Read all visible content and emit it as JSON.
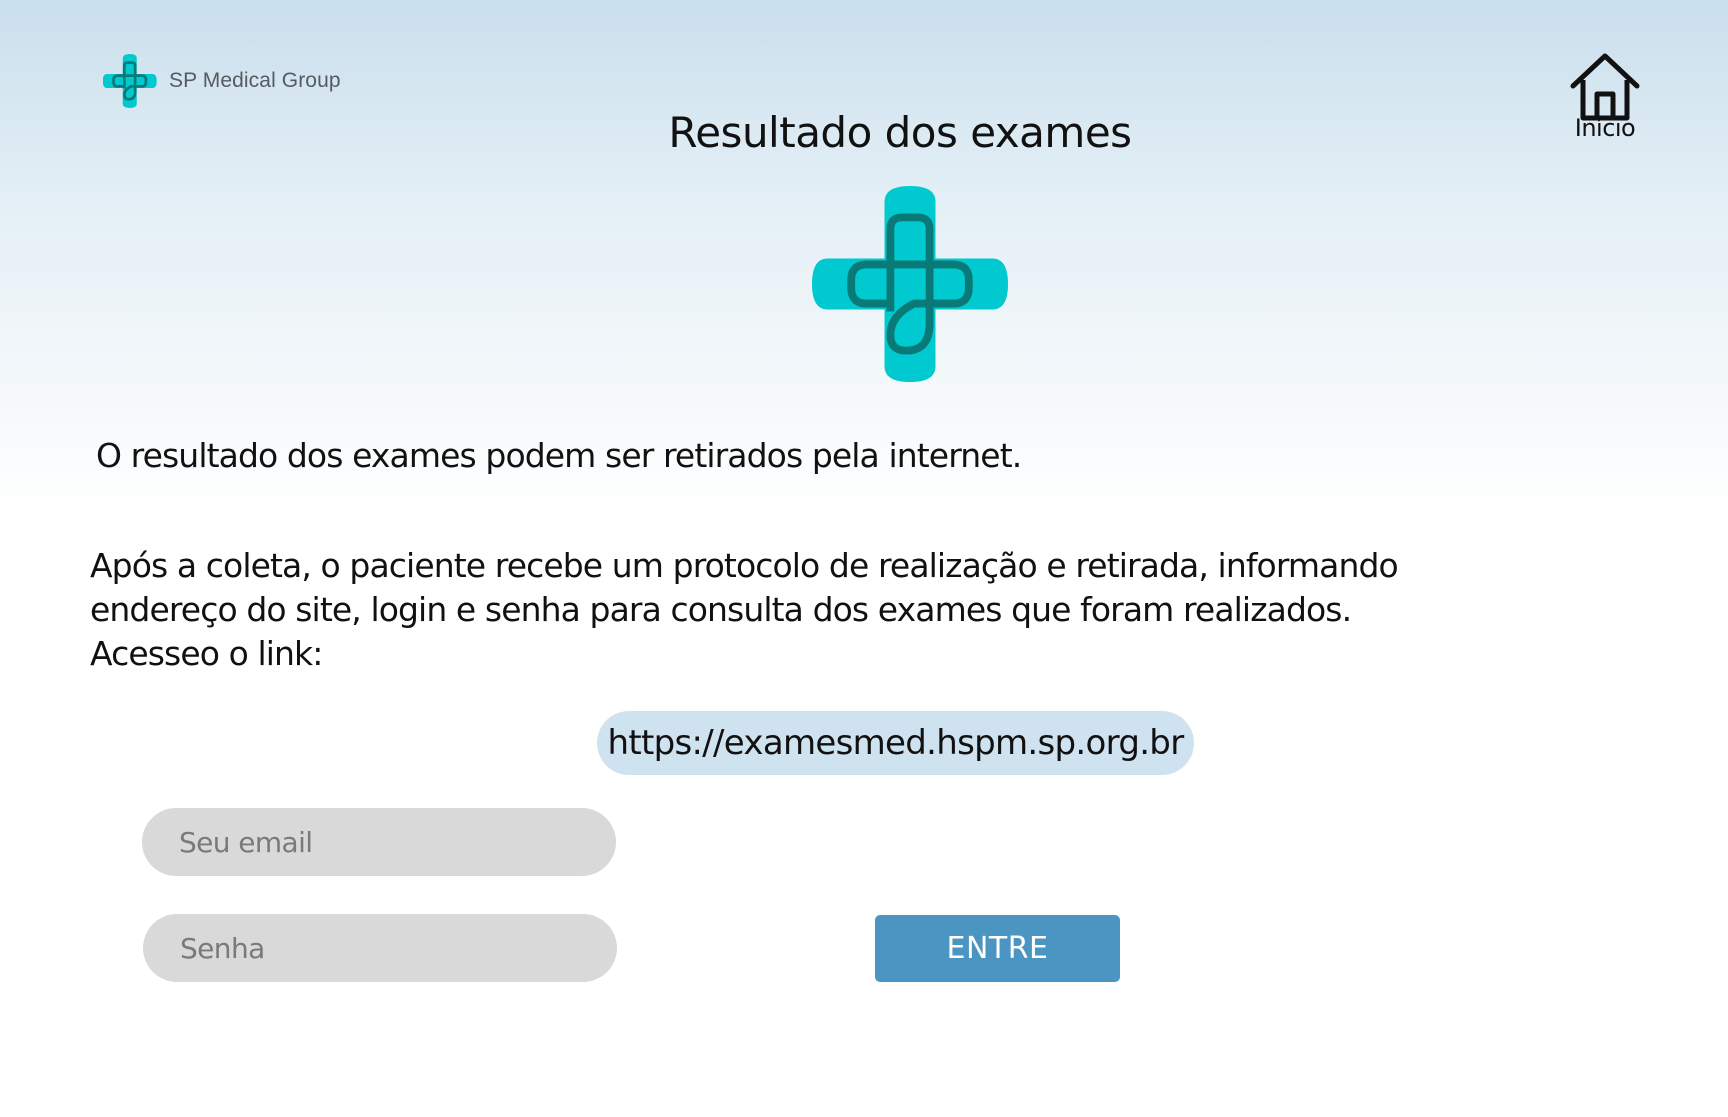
{
  "header": {
    "brand_name": "SP Medical Group",
    "home_label": "Início",
    "logo_icon": "medical-cross-logo-icon",
    "home_icon": "home-icon"
  },
  "main": {
    "title": "Resultado dos exames",
    "intro": "O resultado dos exames podem ser retirados pela internet.",
    "body_lines": [
      "Após a coleta, o paciente recebe um protocolo de realização e retirada, informando",
      "endereço do site, login e senha para consulta dos exames que foram realizados.",
      "Acesseo o link:"
    ],
    "link": "https://examesmed.hspm.sp.org.br"
  },
  "form": {
    "email_placeholder": "Seu email",
    "password_placeholder": "Senha",
    "submit_label": "ENTRE"
  },
  "colors": {
    "brand_cyan": "#00c9cf",
    "brand_cyan_dark": "#0a7a78",
    "link_pill": "#cfe2ef",
    "button": "#4a95c2",
    "field_bg": "#d9d9d9"
  }
}
